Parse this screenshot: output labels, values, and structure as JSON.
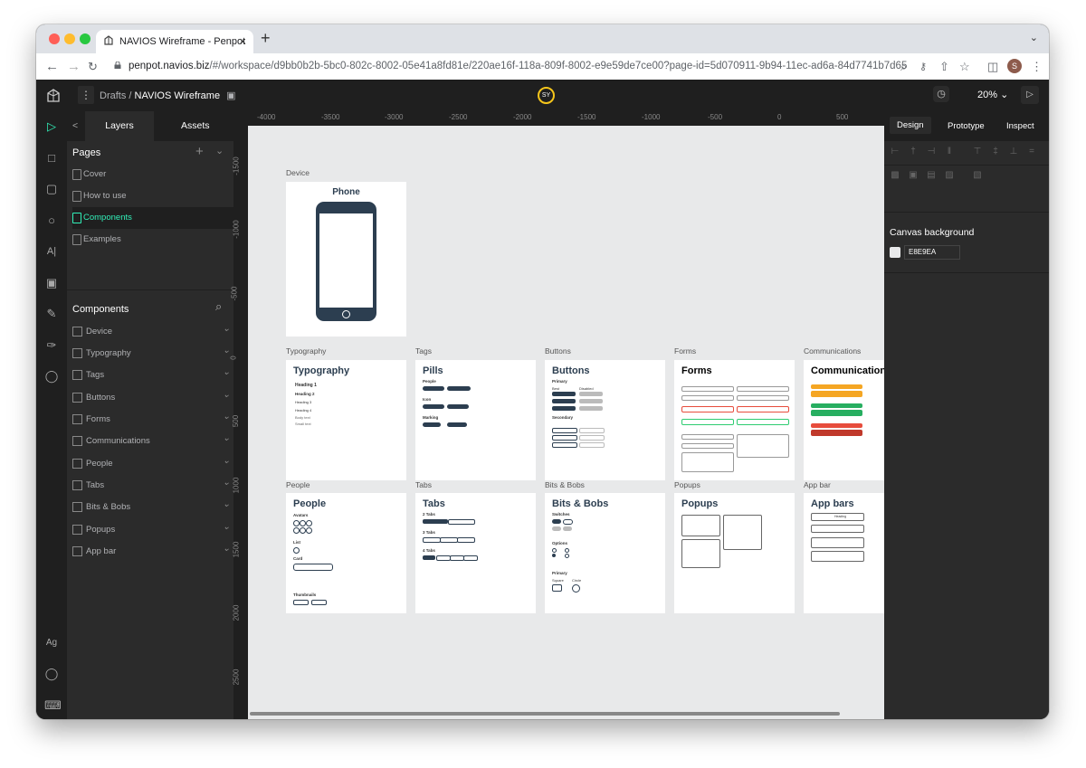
{
  "browser": {
    "tab_title": "NAVIOS Wireframe - Penpot",
    "tab_close": "×",
    "new_tab": "+",
    "url_host": "penpot.navios.biz",
    "url_path": "/#/workspace/d9bb0b2b-5bc0-802c-8002-05e41a8fd81e/220ae16f-118a-809f-8002-e9e59de7ce00?page-id=5d070911-9b94-11ec-ad6a-84d7741b7d65",
    "profile_initial": "S"
  },
  "header": {
    "breadcrumb_parent": "Drafts",
    "breadcrumb_sep": "/",
    "breadcrumb_file": "NAVIOS Wireframe",
    "user_initials": "SY",
    "zoom": "20%"
  },
  "left_panel": {
    "tabs": [
      "Layers",
      "Assets"
    ],
    "pages_title": "Pages",
    "pages": [
      "Cover",
      "How to use",
      "Components",
      "Examples"
    ],
    "selected_page": "Components",
    "components_title": "Components",
    "components": [
      "Device",
      "Typography",
      "Tags",
      "Buttons",
      "Forms",
      "Communications",
      "People",
      "Tabs",
      "Bits & Bobs",
      "Popups",
      "App bar"
    ]
  },
  "left_toolbar": {
    "text_tool": "A|",
    "typography_tool": "Ag"
  },
  "rulers": {
    "horizontal": [
      "-4000",
      "-3500",
      "-3000",
      "-2500",
      "-2000",
      "-1500",
      "-1000",
      "-500",
      "0",
      "500"
    ],
    "vertical": [
      "-1500",
      "-1000",
      "-500",
      "0",
      "500",
      "1000",
      "1500",
      "2000",
      "2500"
    ]
  },
  "canvas": {
    "boards": [
      {
        "label": "Device",
        "title": "Phone"
      },
      {
        "label": "Typography",
        "title": "Typography"
      },
      {
        "label": "Tags",
        "title": "Pills"
      },
      {
        "label": "Buttons",
        "title": "Buttons"
      },
      {
        "label": "Forms",
        "title": "Forms"
      },
      {
        "label": "Communications",
        "title": "Communications"
      },
      {
        "label": "People",
        "title": "People"
      },
      {
        "label": "Tabs",
        "title": "Tabs"
      },
      {
        "label": "Bits & Bobs",
        "title": "Bits & Bobs"
      },
      {
        "label": "Popups",
        "title": "Popups"
      },
      {
        "label": "App bar",
        "title": "App bars"
      }
    ],
    "typography_items": [
      "Heading 1",
      "Heading 2",
      "Heading 3",
      "Heading 4",
      "Body text",
      "Small text"
    ],
    "pills_sections": [
      "People",
      "Icon",
      "Marking"
    ],
    "buttons_sections": [
      "Primary",
      "Secondary"
    ],
    "buttons_cols": [
      "Best",
      "Disabled"
    ],
    "people_sections": [
      "Avatars",
      "List",
      "Card",
      "Thumbnails"
    ],
    "tabs_sections": [
      "2 Tabs",
      "3 Tabs",
      "4 Tabs"
    ],
    "bits_sections": [
      "Switches",
      "Options",
      "Primary"
    ],
    "bits_shapes": [
      "Square",
      "Circle"
    ],
    "appbar_heading": "Heading"
  },
  "right_panel": {
    "tabs": [
      "Design",
      "Prototype",
      "Inspect"
    ],
    "canvas_bg_label": "Canvas background",
    "canvas_bg_hex": "E8E9EA"
  },
  "colors": {
    "accent": "#31efb8",
    "canvas": "#e8e9ea",
    "panel": "#2b2b2b",
    "board_dark": "#2c3e50",
    "user_ring": "#f5c51b"
  }
}
